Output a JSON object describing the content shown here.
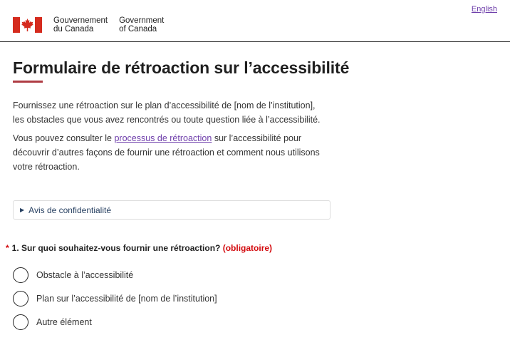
{
  "header": {
    "language_toggle": "English",
    "signature_fr": "Gouvernement\ndu Canada",
    "signature_en": "Government\nof Canada"
  },
  "main": {
    "title": "Formulaire de rétroaction sur l’accessibilité",
    "intro_1": "Fournissez une rétroaction sur le plan d’accessibilité de [nom de l’institution], les obstacles que vous avez rencontrés ou toute question liée à l’accessibilité.",
    "intro_2_before": "Vous pouvez consulter le ",
    "intro_2_link": "processus de rétroaction",
    "intro_2_after": " sur l’accessibilité pour découvrir d’autres façons de fournir une rétroaction et comment nous utilisons votre rétroaction.",
    "privacy_notice": "Avis de confidentialité",
    "question": {
      "required_marker": "*",
      "text": "1. Sur quoi souhaitez-vous fournir une rétroaction? ",
      "required_label": "(obligatoire)",
      "options": [
        "Obstacle à l’accessibilité",
        "Plan sur l’accessibilité de [nom de l’institution]",
        "Autre élément"
      ]
    }
  },
  "colors": {
    "flag_red": "#d52b1e",
    "link": "#6f3fab",
    "required": "#d3080c",
    "title_underline": "#af3c43"
  }
}
